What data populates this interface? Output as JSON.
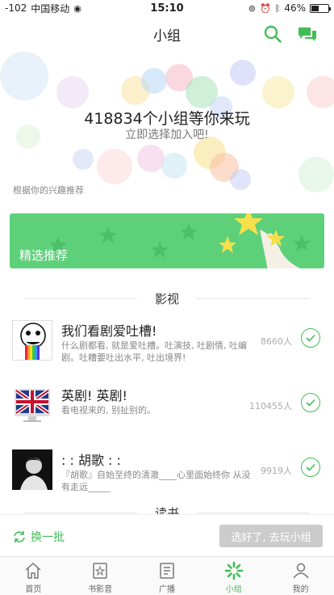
{
  "status_bar": {
    "signal": "-102",
    "carrier": "中国移动",
    "time": "15:10",
    "battery": "46%",
    "battery_level": 0.46
  },
  "nav": {
    "title": "小组",
    "search_icon": "search-icon",
    "chat_icon": "chat-icon",
    "accent": "#42bd56"
  },
  "hero": {
    "title": "418834个小组等你来玩",
    "subtitle": "立即选择加入吧!",
    "note": "根据你的兴趣推荐"
  },
  "banner": {
    "label": "精选推荐",
    "color": "#5ed07a"
  },
  "sections": [
    {
      "label": "影视",
      "items": [
        {
          "name": "我们看剧爱吐槽!",
          "desc": "什么剧都看, 就是爱吐槽。吐演技, 吐剧情, 吐编剧。吐糟要吐出水平, 吐出境界!",
          "count": "8660人",
          "thumb": "rage-face-thumbnail"
        },
        {
          "name": "英剧! 英剧!",
          "desc": "看电视来的, 别扯别的。",
          "count": "110455人",
          "thumb": "union-jack-thumbnail"
        },
        {
          "name": ": : 胡歌 : :",
          "desc": "『胡歌』自始至终的清澈____心里面始终你 从没有走远_____",
          "count": "9919人",
          "thumb": "portrait-thumbnail"
        }
      ]
    },
    {
      "label": "读书",
      "items": []
    }
  ],
  "actions": {
    "refresh_label": "换一批",
    "go_label": "选好了, 去玩小组"
  },
  "tabs": [
    {
      "label": "首页",
      "icon": "home-icon"
    },
    {
      "label": "书影音",
      "icon": "book-movie-icon"
    },
    {
      "label": "广播",
      "icon": "broadcast-icon"
    },
    {
      "label": "小组",
      "icon": "group-icon",
      "active": true
    },
    {
      "label": "我的",
      "icon": "profile-icon"
    }
  ]
}
